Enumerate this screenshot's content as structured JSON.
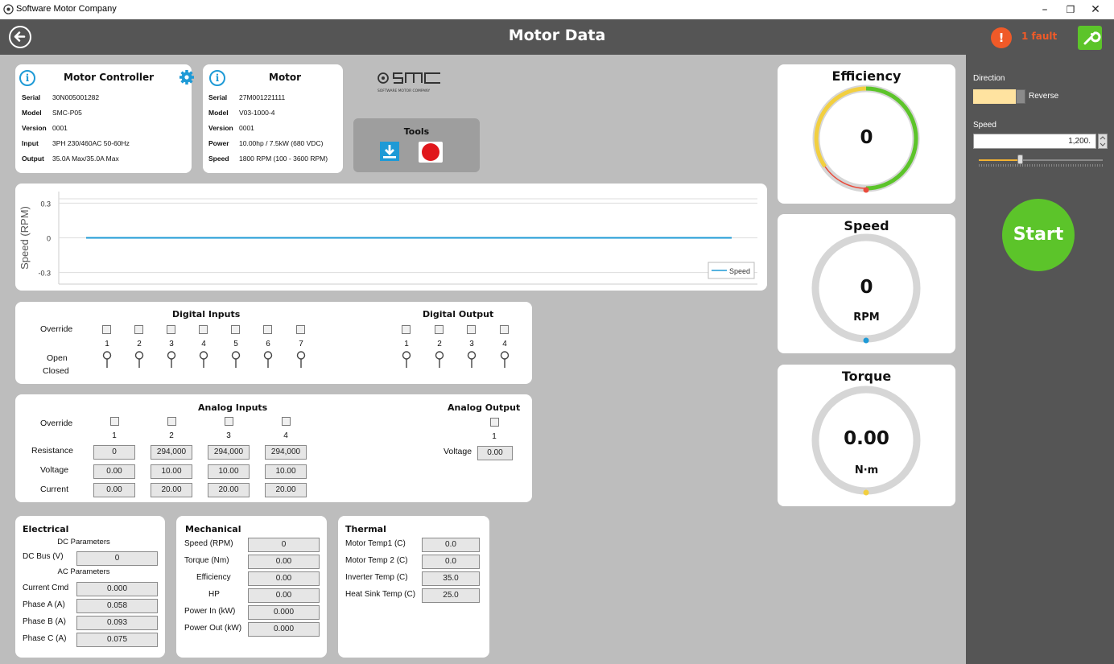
{
  "window": {
    "title": "Software Motor Company",
    "minimize": "–",
    "restore": "❐",
    "close": "✕"
  },
  "header": {
    "title": "Motor Data",
    "fault_icon": "!",
    "fault_text": "1 fault"
  },
  "controller": {
    "title": "Motor Controller",
    "rows": [
      {
        "k": "Serial",
        "v": "30N005001282"
      },
      {
        "k": "Model",
        "v": "SMC-P05"
      },
      {
        "k": "Version",
        "v": "0001"
      },
      {
        "k": "Input",
        "v": "3PH 230/460AC 50-60Hz"
      },
      {
        "k": "Output",
        "v": "35.0A Max/35.0A Max"
      }
    ]
  },
  "motor": {
    "title": "Motor",
    "rows": [
      {
        "k": "Serial",
        "v": "27M001221111"
      },
      {
        "k": "Model",
        "v": "V03-1000-4"
      },
      {
        "k": "Version",
        "v": "0001"
      },
      {
        "k": "Power",
        "v": "10.00hp / 7.5kW (680 VDC)"
      },
      {
        "k": "Speed",
        "v": "1800 RPM (100 - 3600 RPM)"
      }
    ]
  },
  "logo": {
    "tagline": "SOFTWARE MOTOR COMPANY"
  },
  "tools": {
    "title": "Tools"
  },
  "chart_data": {
    "type": "line",
    "ylabel": "Speed (RPM)",
    "yticks": [
      "0.3",
      "0",
      "-0.3"
    ],
    "ylim": [
      -0.4,
      0.4
    ],
    "series": [
      {
        "name": "Speed",
        "values": [
          0,
          0
        ]
      }
    ],
    "legend": "bottom-right",
    "grid": true
  },
  "digital": {
    "inputs_title": "Digital Inputs",
    "output_title": "Digital Output",
    "override": "Override",
    "open": "Open",
    "closed": "Closed",
    "inputs": [
      "1",
      "2",
      "3",
      "4",
      "5",
      "6",
      "7"
    ],
    "outputs": [
      "1",
      "2",
      "3",
      "4"
    ]
  },
  "analog": {
    "inputs_title": "Analog Inputs",
    "output_title": "Analog Output",
    "override": "Override",
    "resistance": "Resistance",
    "voltage": "Voltage",
    "current": "Current",
    "channels": [
      {
        "n": "1",
        "res": "0",
        "volt": "0.00",
        "cur": "0.00"
      },
      {
        "n": "2",
        "res": "294,000",
        "volt": "10.00",
        "cur": "20.00"
      },
      {
        "n": "3",
        "res": "294,000",
        "volt": "10.00",
        "cur": "20.00"
      },
      {
        "n": "4",
        "res": "294,000",
        "volt": "10.00",
        "cur": "20.00"
      }
    ],
    "out_n": "1",
    "out_voltage_label": "Voltage",
    "out_voltage": "0.00"
  },
  "electrical": {
    "title": "Electrical",
    "dc_params": "DC Parameters",
    "ac_params": "AC Parameters",
    "dc_bus_label": "DC Bus (V)",
    "dc_bus": "0",
    "rows": [
      {
        "k": "Current Cmd",
        "v": "0.000"
      },
      {
        "k": "Phase A (A)",
        "v": "0.058"
      },
      {
        "k": "Phase B (A)",
        "v": "0.093"
      },
      {
        "k": "Phase C (A)",
        "v": "0.075"
      }
    ]
  },
  "mechanical": {
    "title": "Mechanical",
    "rows": [
      {
        "k": "Speed (RPM)",
        "v": "0"
      },
      {
        "k": "Torque (Nm)",
        "v": "0.00"
      },
      {
        "k": "Efficiency",
        "v": "0.00"
      },
      {
        "k": "HP",
        "v": "0.00"
      },
      {
        "k": "Power In (kW)",
        "v": "0.000"
      },
      {
        "k": "Power Out (kW)",
        "v": "0.000"
      }
    ]
  },
  "thermal": {
    "title": "Thermal",
    "rows": [
      {
        "k": "Motor Temp1 (C)",
        "v": "0.0"
      },
      {
        "k": "Motor Temp 2 (C)",
        "v": "0.0"
      },
      {
        "k": "Inverter Temp (C)",
        "v": "35.0"
      },
      {
        "k": "Heat Sink Temp (C)",
        "v": "25.0"
      }
    ]
  },
  "gauges": {
    "efficiency": {
      "title": "Efficiency",
      "value": "0"
    },
    "speed": {
      "title": "Speed",
      "value": "0",
      "unit": "RPM"
    },
    "torque": {
      "title": "Torque",
      "value": "0.00",
      "unit": "N·m"
    }
  },
  "side": {
    "direction_label": "Direction",
    "direction_value": "Reverse",
    "speed_label": "Speed",
    "speed_value": "1,200.",
    "speed_fraction": 0.33,
    "start": "Start"
  },
  "colors": {
    "accent_green": "#5cc42a",
    "fault_orange": "#f05a28",
    "info_blue": "#1e9ad6",
    "header_gray": "#555555"
  }
}
